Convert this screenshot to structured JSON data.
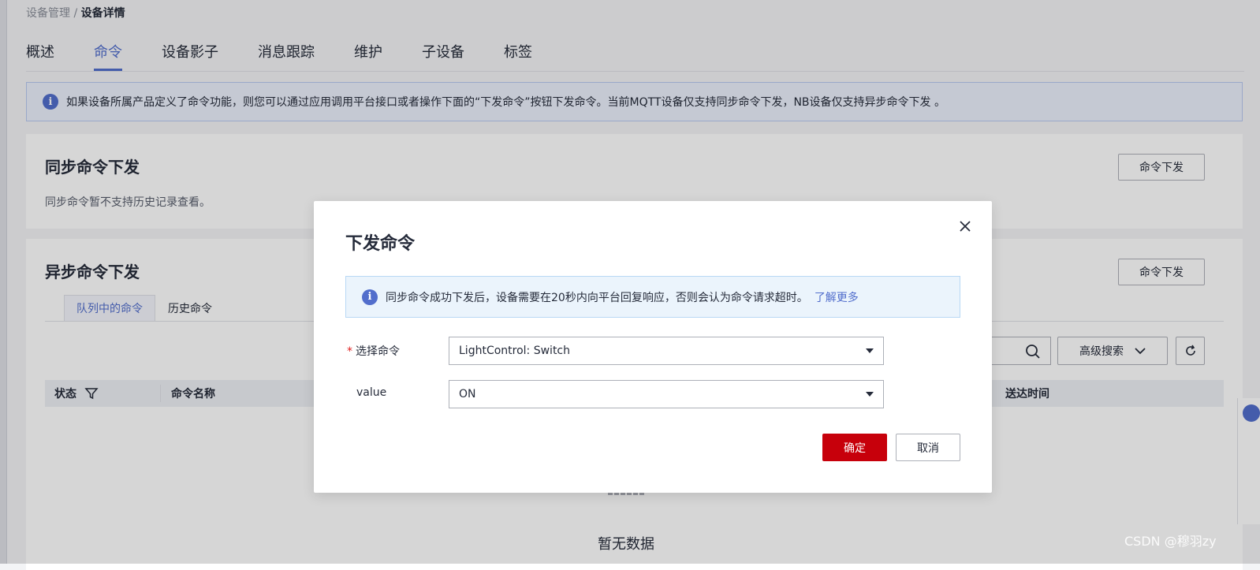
{
  "breadcrumb": {
    "parent": "设备管理",
    "separator": " / ",
    "current": "设备详情"
  },
  "tabs": [
    {
      "label": "概述"
    },
    {
      "label": "命令"
    },
    {
      "label": "设备影子"
    },
    {
      "label": "消息跟踪"
    },
    {
      "label": "维护"
    },
    {
      "label": "子设备"
    },
    {
      "label": "标签"
    }
  ],
  "info_bar": {
    "text": "如果设备所属产品定义了命令功能，则您可以通过应用调用平台接口或者操作下面的“下发命令”按钮下发命令。当前MQTT设备仅支持同步命令下发，NB设备仅支持异步命令下发 。"
  },
  "sync_section": {
    "title": "同步命令下发",
    "subtitle": "同步命令暂不支持历史记录查看。",
    "button": "命令下发"
  },
  "async_section": {
    "title": "异步命令下发",
    "button": "命令下发",
    "subtabs": [
      {
        "label": "队列中的命令"
      },
      {
        "label": "历史命令"
      }
    ],
    "advanced_search": "高级搜索",
    "columns": {
      "status": "状态",
      "name": "命令名称",
      "sent_time": "送达时间"
    },
    "empty_text": "暂无数据"
  },
  "modal": {
    "title": "下发命令",
    "info_text": "同步命令成功下发后，设备需要在20秒内向平台回复响应，否则会认为命令请求超时。",
    "info_link": "了解更多",
    "fields": {
      "command_label": "选择命令",
      "required_mark": "*",
      "command_value": "LightControl: Switch",
      "value_label": "value",
      "value_value": "ON"
    },
    "confirm": "确定",
    "cancel": "取消"
  },
  "watermark": "CSDN @穆羽zy",
  "colors": {
    "accent": "#526ecc",
    "primary_button": "#c7000b",
    "info_bg": "#ebf0fc"
  },
  "icons": [
    "info-icon",
    "close-icon",
    "filter-icon",
    "search-icon",
    "chevron-down-icon",
    "refresh-icon",
    "caret-down-icon"
  ]
}
